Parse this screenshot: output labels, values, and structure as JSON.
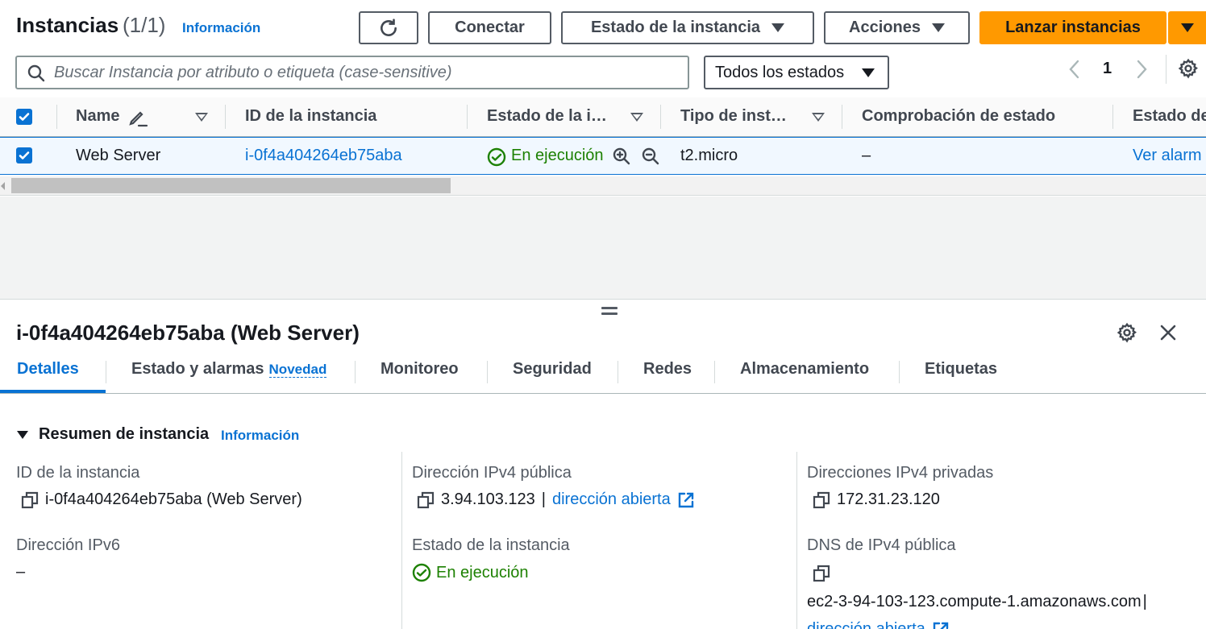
{
  "header": {
    "title": "Instancias",
    "count": "(1/1)",
    "info_link": "Información",
    "buttons": {
      "connect": "Conectar",
      "instance_state": "Estado de la instancia",
      "actions": "Acciones",
      "launch": "Lanzar instancias"
    }
  },
  "filter": {
    "search_placeholder": "Buscar Instancia por atributo o etiqueta (case-sensitive)",
    "state_select": "Todos los estados"
  },
  "pagination": {
    "current_page": "1"
  },
  "table": {
    "columns": [
      "Name",
      "ID de la instancia",
      "Estado de la i…",
      "Tipo de inst…",
      "Comprobación de estado",
      "Estado de"
    ],
    "rows": [
      {
        "name": "Web Server",
        "instance_id": "i-0f4a404264eb75aba",
        "state": "En ejecución",
        "type": "t2.micro",
        "status_check": "–",
        "alarm": "Ver alarm"
      }
    ]
  },
  "panel": {
    "title": "i-0f4a404264eb75aba (Web Server)",
    "tabs": [
      "Detalles",
      "Estado y alarmas",
      "Monitoreo",
      "Seguridad",
      "Redes",
      "Almacenamiento",
      "Etiquetas"
    ],
    "new_badge": "Novedad",
    "summary_title": "Resumen de instancia",
    "summary_info": "Información",
    "fields": {
      "instance_id_label": "ID de la instancia",
      "instance_id_value": "i-0f4a404264eb75aba (Web Server)",
      "public_ipv4_label": "Dirección IPv4 pública",
      "public_ipv4_value": "3.94.103.123",
      "open_address": "dirección abierta",
      "private_ipv4_label": "Direcciones IPv4 privadas",
      "private_ipv4_value": "172.31.23.120",
      "ipv6_label": "Dirección IPv6",
      "ipv6_value": "–",
      "state_label": "Estado de la instancia",
      "state_value": "En ejecución",
      "public_dns_label": "DNS de IPv4 pública",
      "public_dns_value": "ec2-3-94-103-123.compute-1.amazonaws.com",
      "public_dns_open": "dirección abierta"
    }
  },
  "colors": {
    "accent": "#0972d3",
    "launch": "#ff9900",
    "success": "#1d8102",
    "border": "#545b64"
  },
  "icons": [
    "refresh-icon",
    "caret-down-icon",
    "search-icon",
    "chevron-left-icon",
    "chevron-right-icon",
    "gear-icon",
    "checkbox-checked-icon",
    "edit-icon",
    "sort-icon",
    "status-ok-icon",
    "zoom-in-icon",
    "zoom-out-icon",
    "drag-handle-icon",
    "close-icon",
    "copy-icon",
    "external-link-icon"
  ]
}
